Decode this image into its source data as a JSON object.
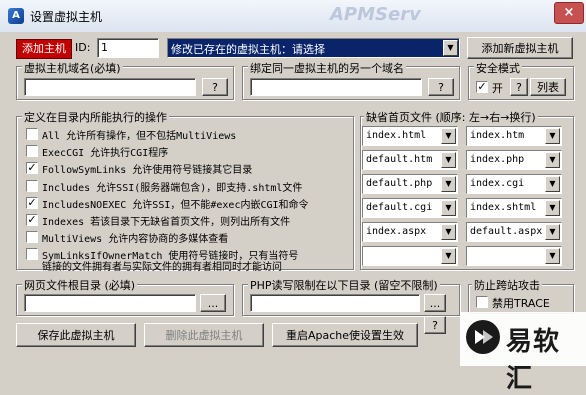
{
  "window": {
    "title": "设置虚拟主机",
    "watermark": "APMServ",
    "close_glyph": "×"
  },
  "top": {
    "add_host_tag": "添加主机",
    "id_label": "ID:",
    "id_value": "1",
    "host_select": "修改已存在的虚拟主机：请选择",
    "add_new_button": "添加新虚拟主机"
  },
  "domain": {
    "label": "虚拟主机域名(必填)",
    "value": "",
    "help": "?"
  },
  "alias": {
    "label": "绑定同一虚拟主机的另一个域名",
    "value": "",
    "help": "?"
  },
  "security": {
    "label": "安全模式",
    "on_label": "开",
    "on_checked": true,
    "help": "?",
    "list_button": "列表"
  },
  "options": {
    "label": "定义在目录内所能执行的操作",
    "items": [
      {
        "checked": false,
        "text": "All 允许所有操作，但不包括MultiViews"
      },
      {
        "checked": false,
        "text": "ExecCGI 允许执行CGI程序"
      },
      {
        "checked": true,
        "text": "FollowSymLinks 允许使用符号链接其它目录"
      },
      {
        "checked": false,
        "text": "Includes 允许SSI(服务器端包含)，即支持.shtml文件"
      },
      {
        "checked": true,
        "text": "IncludesNOEXEC 允许SSI，但不能#exec内嵌CGI和命令"
      },
      {
        "checked": true,
        "text": "Indexes 若该目录下无缺省首页文件，则列出所有文件"
      },
      {
        "checked": false,
        "text": "MultiViews 允许内容协商的多媒体查看"
      },
      {
        "checked": false,
        "text": "SymLinksIfOwnerMatch 使用符号链接时，只有当符号",
        "text2": "链接的文件拥有者与实际文件的拥有者相同时才能访问"
      }
    ]
  },
  "index_files": {
    "label": "缺省首页文件 (顺序: 左→右→换行)",
    "rows": [
      [
        "index.html",
        "index.htm"
      ],
      [
        "default.htm",
        "index.php"
      ],
      [
        "default.php",
        "index.cgi"
      ],
      [
        "default.cgi",
        "index.shtml"
      ],
      [
        "index.aspx",
        "default.aspx"
      ],
      [
        "",
        ""
      ]
    ]
  },
  "webroot": {
    "label": "网页文件根目录 (必填)",
    "value": "",
    "browse": "..."
  },
  "php_dir": {
    "label": "PHP读写限制在以下目录 (留空不限制)",
    "value": "",
    "browse": "...",
    "help": "?"
  },
  "anti_leech": {
    "label": "防止跨站攻击",
    "trace_label": "禁用TRACE",
    "trace_checked": false
  },
  "bottom": {
    "save_button": "保存此虚拟主机",
    "delete_button": "删除此虚拟主机",
    "restart_button": "重启Apache使设置生效"
  },
  "brand": {
    "text": "易软汇",
    "accent": "#1a1a1a"
  }
}
